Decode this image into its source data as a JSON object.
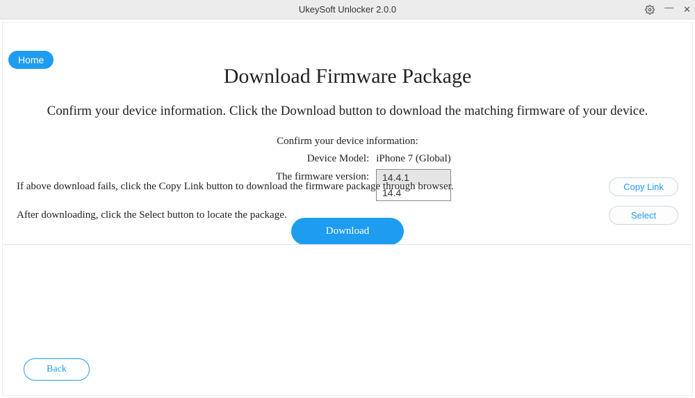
{
  "titlebar": {
    "title": "UkeySoft Unlocker 2.0.0"
  },
  "nav": {
    "home": "Home"
  },
  "page": {
    "title": "Download Firmware Package",
    "subtitle": "Confirm your device information. Click the Download button to download the matching firmware of your device.",
    "confirm_label": "Confirm your device information:",
    "device_model_label": "Device Model:",
    "device_model_value": "iPhone 7 (Global)",
    "firmware_version_label": "The firmware version:",
    "firmware_versions": [
      "14.4.1",
      "14.4"
    ],
    "firmware_selected": "14.4.1",
    "download_button": "Download"
  },
  "fallback": {
    "copy_text": "If above download fails, click the Copy Link button to download the firmware package through browser.",
    "select_text": "After downloading, click the Select button to locate the package.",
    "copy_button": "Copy Link",
    "select_button": "Select"
  },
  "footer": {
    "back_button": "Back"
  }
}
